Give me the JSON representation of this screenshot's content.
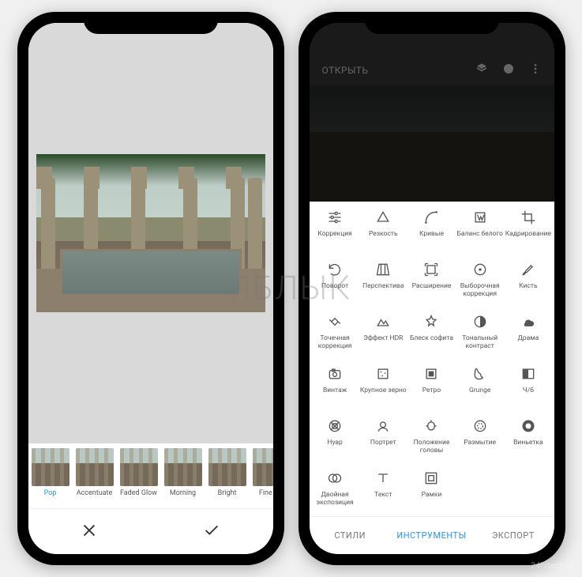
{
  "watermark": "ЯБЛЫК",
  "source_mark": "24hitech.ru",
  "left": {
    "filters": [
      {
        "label": "Pop"
      },
      {
        "label": "Accentuate"
      },
      {
        "label": "Faded Glow"
      },
      {
        "label": "Morning"
      },
      {
        "label": "Bright"
      },
      {
        "label": "Fine Art"
      }
    ]
  },
  "right": {
    "appbar": {
      "open_label": "ОТКРЫТЬ"
    },
    "tools": [
      {
        "label": "Коррекция",
        "icon": "tune"
      },
      {
        "label": "Резкость",
        "icon": "details"
      },
      {
        "label": "Кривые",
        "icon": "curves"
      },
      {
        "label": "Баланс белого",
        "icon": "wb"
      },
      {
        "label": "Кадрирование",
        "icon": "crop"
      },
      {
        "label": "Поворот",
        "icon": "rotate"
      },
      {
        "label": "Перспектива",
        "icon": "perspective"
      },
      {
        "label": "Расширение",
        "icon": "expand"
      },
      {
        "label": "Выборочная коррекция",
        "icon": "radial"
      },
      {
        "label": "Кисть",
        "icon": "brush"
      },
      {
        "label": "Точечная коррекция",
        "icon": "heal"
      },
      {
        "label": "Эффект HDR",
        "icon": "hdr"
      },
      {
        "label": "Блеск софита",
        "icon": "glamour"
      },
      {
        "label": "Тональный контраст",
        "icon": "tonal"
      },
      {
        "label": "Драма",
        "icon": "drama"
      },
      {
        "label": "Винтаж",
        "icon": "vintage"
      },
      {
        "label": "Крупное зерно",
        "icon": "grain"
      },
      {
        "label": "Ретро",
        "icon": "retro"
      },
      {
        "label": "Grunge",
        "icon": "grunge"
      },
      {
        "label": "Ч/б",
        "icon": "bw"
      },
      {
        "label": "Нуар",
        "icon": "noir"
      },
      {
        "label": "Портрет",
        "icon": "portrait"
      },
      {
        "label": "Положение головы",
        "icon": "headpose"
      },
      {
        "label": "Размытие",
        "icon": "blur"
      },
      {
        "label": "Виньетка",
        "icon": "vignette"
      },
      {
        "label": "Двойная экспозиция",
        "icon": "double"
      },
      {
        "label": "Текст",
        "icon": "text"
      },
      {
        "label": "Рамки",
        "icon": "frames"
      }
    ],
    "tabs": {
      "styles": "СТИЛИ",
      "tools": "ИНСТРУМЕНТЫ",
      "export": "ЭКСПОРТ"
    }
  }
}
